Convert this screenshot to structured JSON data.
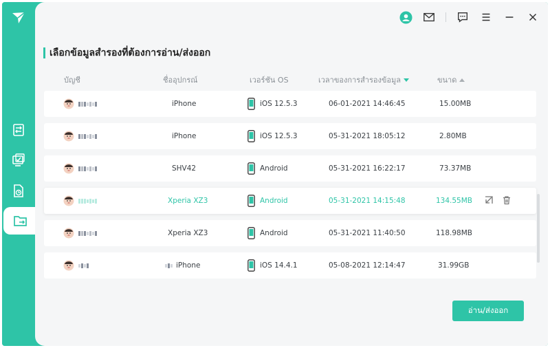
{
  "app": {
    "title": "เลือกข้อมูลสำรองที่ต้องการอ่าน/ส่งออก"
  },
  "sidebar": {
    "items": [
      {
        "name": "sidebar-item-transfer",
        "icon": "transfer-doc-icon"
      },
      {
        "name": "sidebar-item-device",
        "icon": "device-check-icon"
      },
      {
        "name": "sidebar-item-recover",
        "icon": "recover-file-icon"
      },
      {
        "name": "sidebar-item-export",
        "icon": "folder-export-icon"
      }
    ]
  },
  "columns": {
    "account": "บัญชี",
    "device": "ชื่ออุปกรณ์",
    "os": "เวอร์ชัน OS",
    "time": "เวลาของการสำรองข้อมูล",
    "size": "ขนาด"
  },
  "rows": [
    {
      "device": "iPhone",
      "os": "iOS 12.5.3",
      "time": "06-01-2021 14:46:45",
      "size": "15.00MB"
    },
    {
      "device": "iPhone",
      "os": "iOS 12.5.3",
      "time": "05-31-2021 18:05:12",
      "size": "2.80MB"
    },
    {
      "device": "SHV42",
      "os": "Android",
      "time": "05-31-2021 16:22:17",
      "size": "73.37MB"
    },
    {
      "device": "Xperia XZ3",
      "os": "Android",
      "time": "05-31-2021 14:15:48",
      "size": "134.55MB"
    },
    {
      "device": "Xperia XZ3",
      "os": "Android",
      "time": "05-31-2021 11:40:50",
      "size": "118.98MB"
    },
    {
      "device": "iPhone",
      "os": "iOS 14.4.1",
      "time": "05-08-2021 12:14:47",
      "size": "31.99GB"
    }
  ],
  "actions": {
    "export_label": "อ่าน/ส่งออก"
  },
  "colors": {
    "accent": "#2ec4a7",
    "background": "#f5f6f7"
  }
}
